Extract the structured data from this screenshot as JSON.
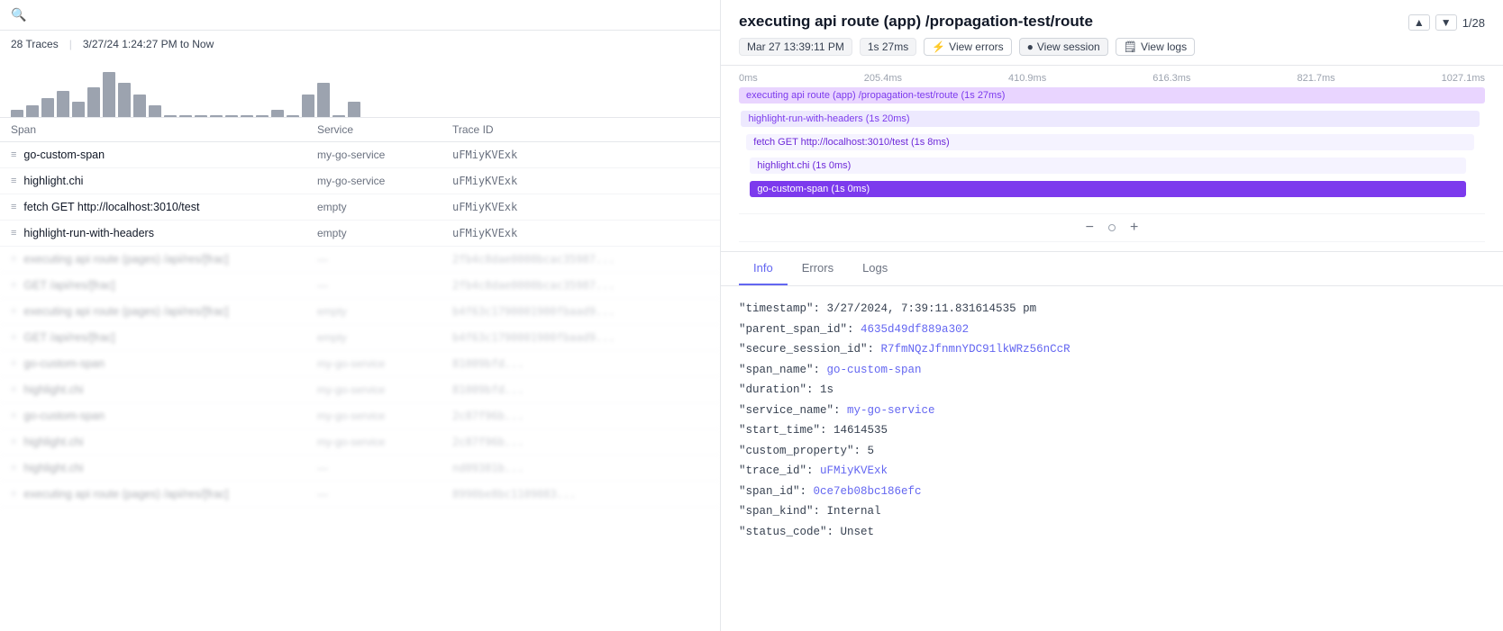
{
  "left": {
    "search_placeholder": "Search...",
    "traces_count": "28 Traces",
    "date_range": "3/27/24 1:24:27 PM to Now",
    "columns": {
      "span": "Span",
      "service": "Service",
      "trace_id": "Trace ID"
    },
    "histogram_bars": [
      2,
      3,
      5,
      7,
      4,
      8,
      12,
      9,
      6,
      3,
      0,
      0,
      0,
      0,
      0,
      0,
      0,
      2,
      0,
      6,
      9,
      0,
      4
    ],
    "traces": [
      {
        "span": "go-custom-span",
        "service": "my-go-service",
        "trace_id": "uFMiyKVExk",
        "blurred": false
      },
      {
        "span": "highlight.chi",
        "service": "my-go-service",
        "trace_id": "uFMiyKVExk",
        "blurred": false
      },
      {
        "span": "fetch GET http://localhost:3010/test",
        "service": "empty",
        "trace_id": "uFMiyKVExk",
        "blurred": false
      },
      {
        "span": "highlight-run-with-headers",
        "service": "empty",
        "trace_id": "uFMiyKVExk",
        "blurred": false
      },
      {
        "span": "executing api route (pages) /api/res/[frac]",
        "service": "—",
        "trace_id": "2fb4c8dae0000bcac35987...",
        "blurred": true
      },
      {
        "span": "GET /api/res/[frac]",
        "service": "—",
        "trace_id": "2fb4c8dae0000bcac35987...",
        "blurred": true
      },
      {
        "span": "executing api route (pages) /api/res/[frac]",
        "service": "empty",
        "trace_id": "b4f63c1790001900fbaad9...",
        "blurred": true
      },
      {
        "span": "GET /api/res/[frac]",
        "service": "empty",
        "trace_id": "b4f63c1790001900fbaad9...",
        "blurred": true
      },
      {
        "span": "go-custom-span",
        "service": "my-go-service",
        "trace_id": "81009bfd...",
        "blurred": true
      },
      {
        "span": "highlight.chi",
        "service": "my-go-service",
        "trace_id": "81009bfd...",
        "blurred": true
      },
      {
        "span": "go-custom-span",
        "service": "my-go-service",
        "trace_id": "2c87f96b...",
        "blurred": true
      },
      {
        "span": "highlight.chi",
        "service": "my-go-service",
        "trace_id": "2c87f96b...",
        "blurred": true
      },
      {
        "span": "highlight.chi",
        "service": "—",
        "trace_id": "nd09381b...",
        "blurred": true
      },
      {
        "span": "executing api route (pages) /api/res/[frac]",
        "service": "—",
        "trace_id": "8990be8bc1109083...",
        "blurred": true
      }
    ]
  },
  "right": {
    "nav_prev": "▲",
    "nav_next": "▼",
    "nav_count": "1/28",
    "title": "executing api route (app) /propagation-test/route",
    "date": "Mar 27 13:39:11 PM",
    "duration": "1s 27ms",
    "btn_errors": "View errors",
    "btn_session": "View session",
    "btn_logs": "View logs",
    "ruler": {
      "marks": [
        "0ms",
        "205.4ms",
        "410.9ms",
        "616.3ms",
        "821.7ms",
        "1027.1ms"
      ]
    },
    "spans": [
      {
        "label": "executing api route (app) /propagation-test/route (1s 27ms)",
        "color": "#e9d5ff",
        "text_color": "#7c3aed",
        "left_pct": 0,
        "width_pct": 100
      },
      {
        "label": "highlight-run-with-headers (1s 20ms)",
        "color": "#ede9fe",
        "text_color": "#7c3aed",
        "left_pct": 0.3,
        "width_pct": 99
      },
      {
        "label": "fetch GET http://localhost:3010/test (1s 8ms)",
        "color": "#f5f3ff",
        "text_color": "#6d28d9",
        "left_pct": 1,
        "width_pct": 97.5
      },
      {
        "label": "highlight.chi (1s 0ms)",
        "color": "#f5f3ff",
        "text_color": "#6d28d9",
        "left_pct": 1.5,
        "width_pct": 96
      },
      {
        "label": "go-custom-span (1s 0ms)",
        "color": "#7c3aed",
        "text_color": "#fff",
        "left_pct": 1.5,
        "width_pct": 96
      }
    ],
    "tabs": [
      "Info",
      "Errors",
      "Logs"
    ],
    "active_tab": "Info",
    "info": {
      "fields": [
        {
          "key": "\"timestamp\"",
          "value": "3/27/2024, 7:39:11.831614535 pm",
          "type": "text"
        },
        {
          "key": "\"parent_span_id\"",
          "value": "4635d49df889a302",
          "type": "link"
        },
        {
          "key": "\"secure_session_id\"",
          "value": "R7fmNQzJfnmnYDC91lkWRz56nCcR",
          "type": "link"
        },
        {
          "key": "\"span_name\"",
          "value": "go-custom-span",
          "type": "link"
        },
        {
          "key": "\"duration\"",
          "value": "1s",
          "type": "text"
        },
        {
          "key": "\"service_name\"",
          "value": "my-go-service",
          "type": "link"
        },
        {
          "key": "\"start_time\"",
          "value": "14614535",
          "type": "text"
        },
        {
          "key": "\"custom_property\"",
          "value": "5",
          "type": "text"
        },
        {
          "key": "\"trace_id\"",
          "value": "uFMiyKVExk",
          "type": "link"
        },
        {
          "key": "\"span_id\"",
          "value": "0ce7eb08bc186efc",
          "type": "link"
        },
        {
          "key": "\"span_kind\"",
          "value": "Internal",
          "type": "text"
        },
        {
          "key": "\"status_code\"",
          "value": "Unset",
          "type": "text"
        }
      ]
    }
  }
}
